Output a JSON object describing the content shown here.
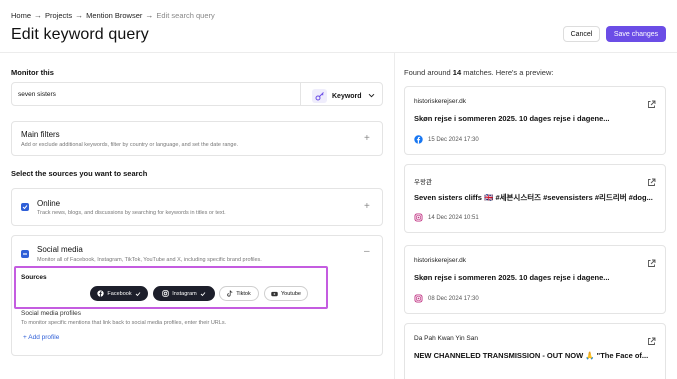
{
  "breadcrumb": {
    "items": [
      "Home",
      "Projects",
      "Mention Browser"
    ],
    "current": "Edit search query",
    "separator": "→"
  },
  "page": {
    "title": "Edit keyword query"
  },
  "actions": {
    "cancel_label": "Cancel",
    "save_label": "Save changes"
  },
  "monitor": {
    "label": "Monitor this",
    "value": "seven sisters",
    "type_label": "Keyword"
  },
  "main_filters": {
    "title": "Main filters",
    "description": "Add or exclude additional keywords, filter by country or language, and set the date range."
  },
  "sources_section": {
    "label": "Select the sources you want to search"
  },
  "online": {
    "title": "Online",
    "description": "Track news, blogs, and discussions by searching for keywords in titles or text.",
    "checked": true
  },
  "social_media": {
    "title": "Social media",
    "description": "Monitor all of Facebook, Instagram, TikTok, YouTube and X, including specific brand profiles.",
    "checked": true,
    "sources_title": "Sources",
    "chips": [
      {
        "label": "Facebook",
        "selected": true,
        "icon": "facebook-icon"
      },
      {
        "label": "Instagram",
        "selected": true,
        "icon": "instagram-icon"
      },
      {
        "label": "Tiktok",
        "selected": false,
        "icon": "tiktok-icon"
      },
      {
        "label": "Youtube",
        "selected": false,
        "icon": "youtube-icon"
      }
    ],
    "profiles_title": "Social media profiles",
    "profiles_description": "To monitor specific mentions that link back to social media profiles, enter their URLs.",
    "add_profile_label": "+ Add profile"
  },
  "preview": {
    "found_prefix": "Found around",
    "count": "14",
    "found_suffix": "matches. Here's a preview:",
    "mentions": [
      {
        "source": "historiskerejser.dk",
        "headline": "Skøn rejse i sommeren 2025. 10 dages rejse i dagene...",
        "date": "15 Dec 2024 17:30",
        "platform": "facebook"
      },
      {
        "source": "우왕관",
        "headline": "Seven sisters cliffs 🇬🇧 #세븐시스터즈 #sevensisters #리드리버 #dog...",
        "date": "14 Dec 2024 10:51",
        "platform": "instagram"
      },
      {
        "source": "historiskerejser.dk",
        "headline": "Skøn rejse i sommeren 2025. 10 dages rejse i dagene...",
        "date": "08 Dec 2024 17:30",
        "platform": "instagram"
      },
      {
        "source": "Da Pah Kwan Yin San",
        "headline": "NEW CHANNELED TRANSMISSION - OUT NOW 🙏 \"The Face of...",
        "date": "",
        "platform": ""
      }
    ]
  },
  "colors": {
    "accent": "#6b4de6",
    "checkbox": "#2f5fd7",
    "highlight": "#c45ce0",
    "chip_on": "#1d1f2b",
    "facebook": "#1877f2",
    "instagram": "#c13584"
  }
}
